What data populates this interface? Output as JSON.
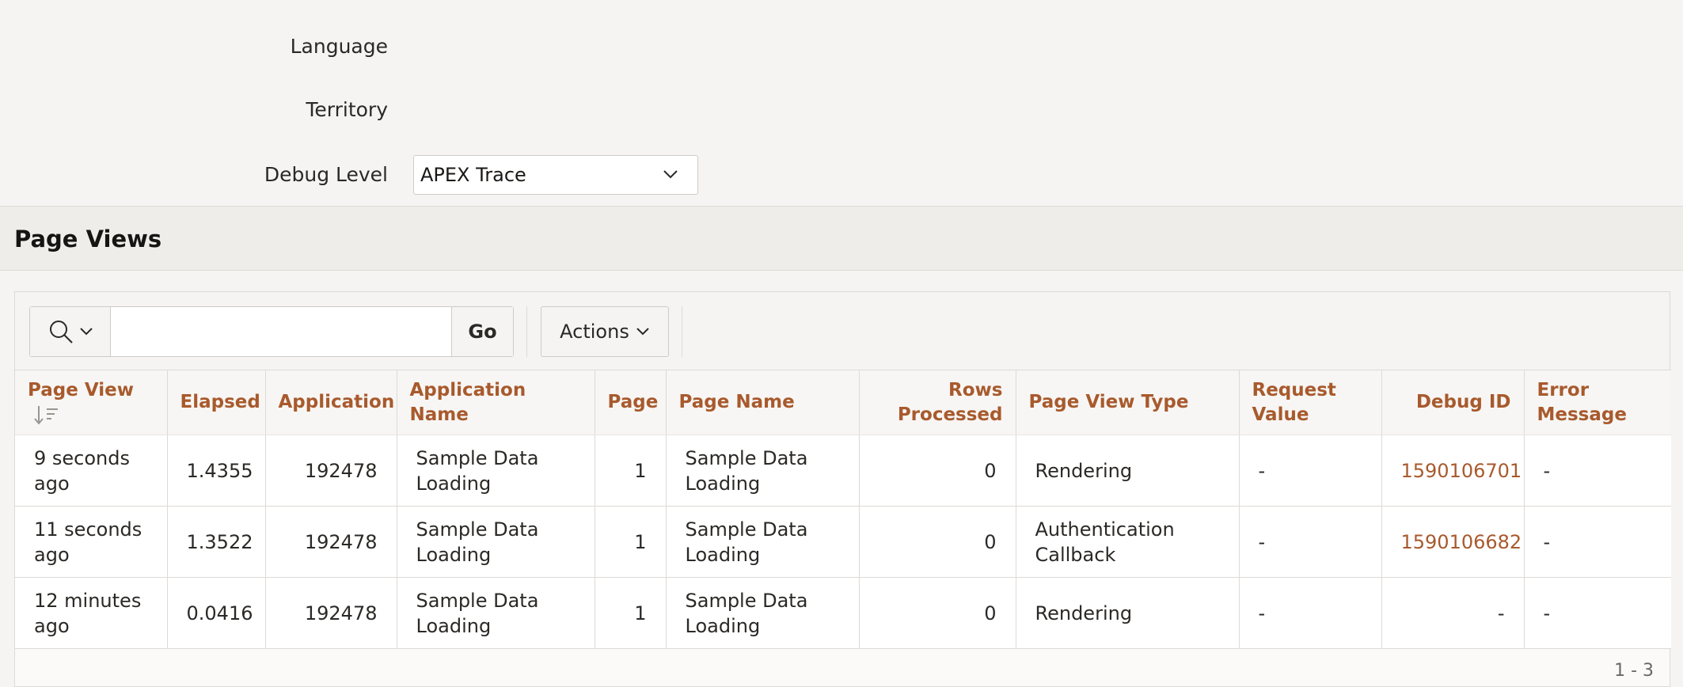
{
  "form": {
    "language_label": "Language",
    "territory_label": "Territory",
    "debug_level_label": "Debug Level",
    "debug_level_value": "APEX Trace"
  },
  "region": {
    "title": "Page Views"
  },
  "toolbar": {
    "search_icon": "search-icon",
    "search_placeholder": "",
    "go_label": "Go",
    "actions_label": "Actions"
  },
  "table": {
    "columns": [
      "Page View",
      "Elapsed",
      "Application",
      "Application Name",
      "Page",
      "Page Name",
      "Rows Processed",
      "Page View Type",
      "Request Value",
      "Debug ID",
      "Error Message"
    ],
    "rows": [
      [
        "9 seconds ago",
        "1.4355",
        "192478",
        "Sample Data Loading",
        "1",
        "Sample Data Loading",
        "0",
        "Rendering",
        "-",
        "1590106701",
        "-"
      ],
      [
        "11 seconds ago",
        "1.3522",
        "192478",
        "Sample Data Loading",
        "1",
        "Sample Data Loading",
        "0",
        "Authentication Callback",
        "-",
        "1590106682",
        "-"
      ],
      [
        "12 minutes ago",
        "0.0416",
        "192478",
        "Sample Data Loading",
        "1",
        "Sample Data Loading",
        "0",
        "Rendering",
        "-",
        "-",
        "-"
      ]
    ]
  },
  "pagination": "1 - 3",
  "colors": {
    "accent": "#a85a2d",
    "background": "#f5f4f2"
  }
}
